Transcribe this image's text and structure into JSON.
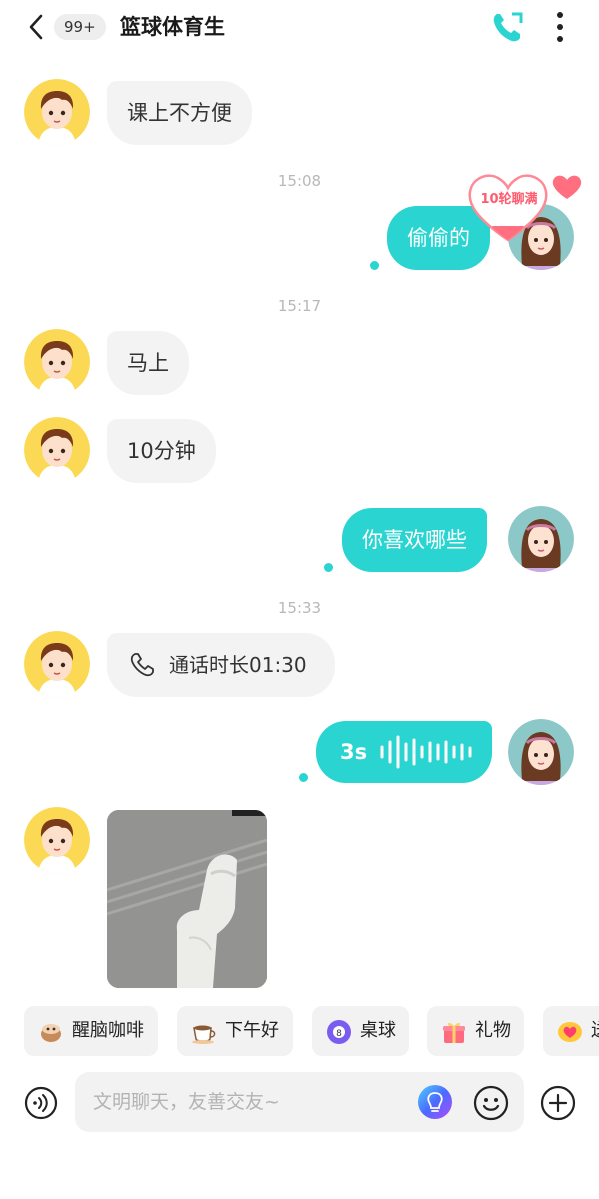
{
  "header": {
    "unread_count": "99+",
    "title": "篮球体育生",
    "back_icon": "chevron-left-icon",
    "call_icon": "phone-icon",
    "more_icon": "more-vertical-icon"
  },
  "messages": [
    {
      "side": "in",
      "text": "课上不方便"
    },
    {
      "timestamp": "15:08"
    },
    {
      "side": "out",
      "text": "偷偷的",
      "badge": "10轮聊满"
    },
    {
      "timestamp": "15:17"
    },
    {
      "side": "in",
      "text": "马上"
    },
    {
      "side": "in",
      "text": "10分钟"
    },
    {
      "side": "out",
      "text": "你喜欢哪些"
    },
    {
      "timestamp": "15:33"
    },
    {
      "side": "in",
      "type": "call",
      "text": "通话时长01:30"
    },
    {
      "side": "out",
      "type": "voice",
      "duration": "3s"
    },
    {
      "side": "in",
      "type": "image",
      "description_icon": "photo"
    }
  ],
  "quick_chips": [
    {
      "label": "醒脑咖啡",
      "icon": "coffee-bean-icon"
    },
    {
      "label": "下午好",
      "icon": "coffee-cup-icon"
    },
    {
      "label": "桌球",
      "icon": "billiard-ball-icon"
    },
    {
      "label": "礼物",
      "icon": "gift-icon"
    },
    {
      "label": "送",
      "icon": "heart-bubble-icon"
    }
  ],
  "input": {
    "placeholder": "文明聊天，友善交友~",
    "value": ""
  },
  "colors": {
    "accent": "#2ad4d0",
    "incoming_bubble": "#f3f3f3",
    "badge_pink": "#ff5a6e"
  }
}
